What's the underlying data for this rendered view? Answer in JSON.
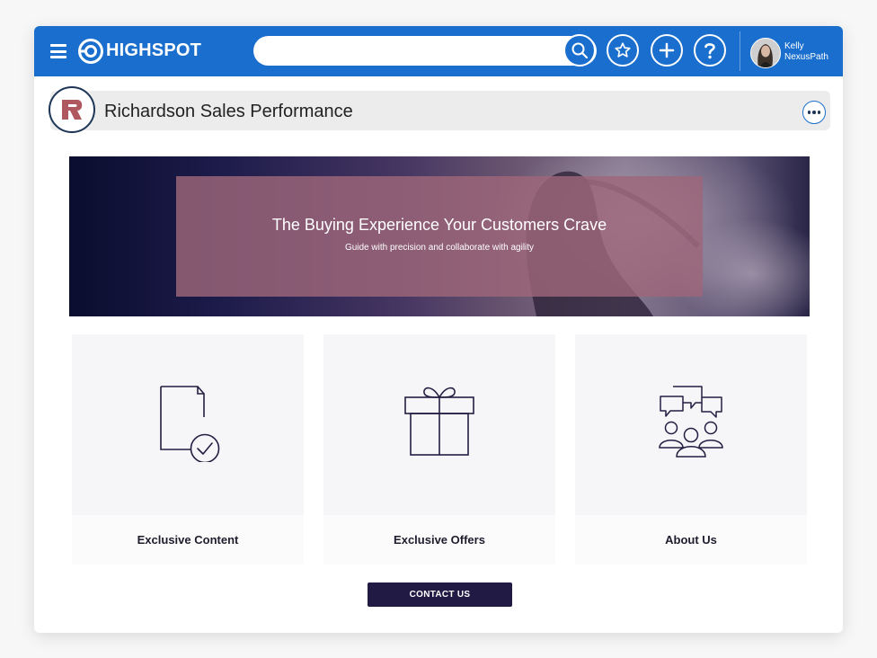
{
  "topbar": {
    "logo_text": "HIGHSPOT",
    "search": {
      "value": "",
      "placeholder": ""
    },
    "user": {
      "first_name": "Kelly",
      "last_name": "NexusPath"
    }
  },
  "page": {
    "title": "Richardson Sales Performance"
  },
  "hero": {
    "title": "The Buying Experience Your Customers Crave",
    "subtitle": "Guide with precision and collaborate with agility"
  },
  "cards": [
    {
      "label": "Exclusive Content",
      "icon": "document-check-icon"
    },
    {
      "label": "Exclusive Offers",
      "icon": "gift-icon"
    },
    {
      "label": "About Us",
      "icon": "community-chat-icon"
    }
  ],
  "contact_button": {
    "label": "CONTACT US"
  },
  "colors": {
    "topbar": "#1a6fce",
    "brand_accent": "#b0585f",
    "dark_navy": "#211a44",
    "hero_overlay": "#9e667a"
  }
}
